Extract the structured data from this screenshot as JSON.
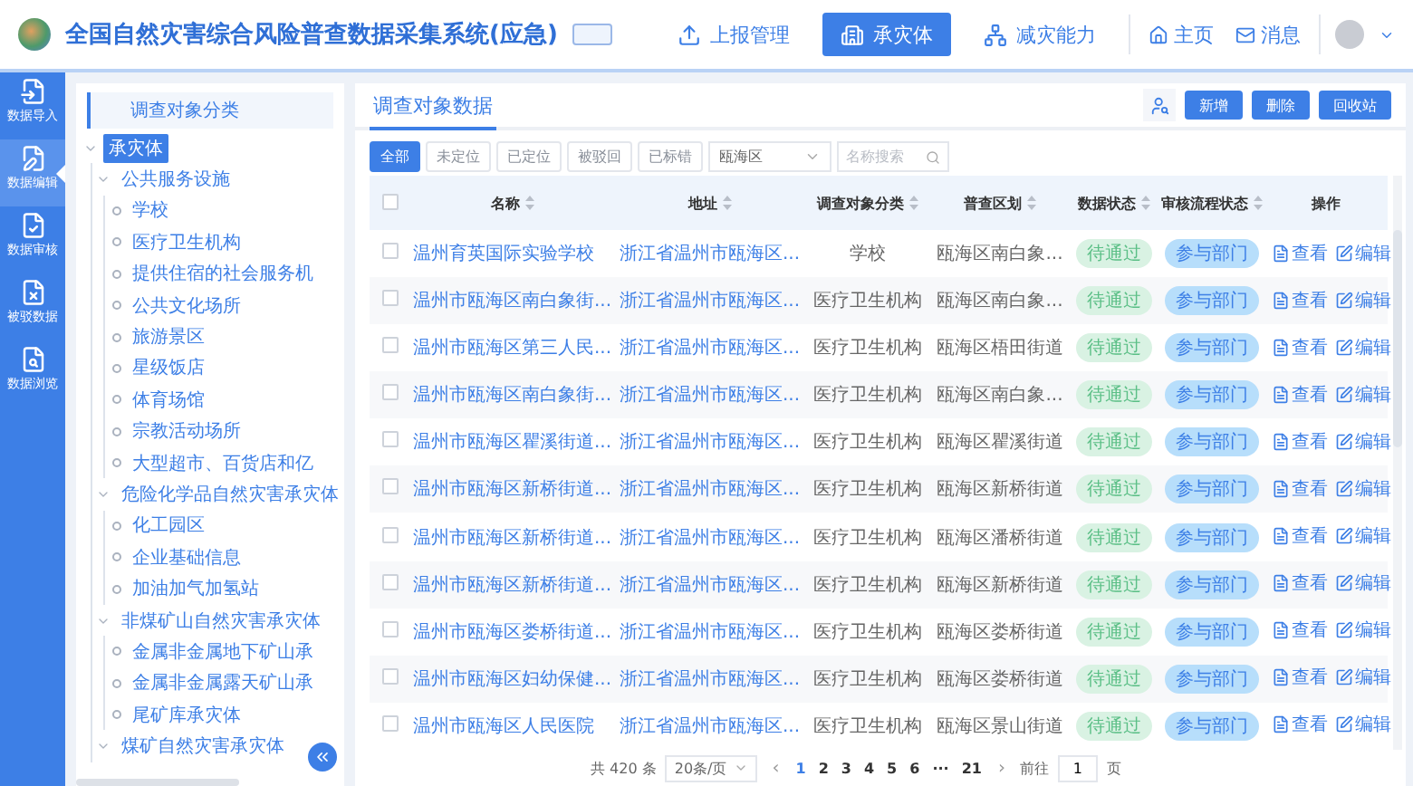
{
  "header": {
    "title": "全国自然灾害综合风险普查数据采集系统(应急)",
    "nav": [
      {
        "label": "上报管理",
        "selected": false
      },
      {
        "label": "承灾体",
        "selected": true
      },
      {
        "label": "减灾能力",
        "selected": false
      }
    ],
    "links": [
      {
        "label": "主页"
      },
      {
        "label": "消息"
      }
    ]
  },
  "rail": [
    {
      "label": "数据导入",
      "selected": false
    },
    {
      "label": "数据编辑",
      "selected": true
    },
    {
      "label": "数据审核",
      "selected": false
    },
    {
      "label": "被驳数据",
      "selected": false
    },
    {
      "label": "数据浏览",
      "selected": false
    }
  ],
  "tree": {
    "title": "调查对象分类",
    "items": [
      {
        "label": "承灾体",
        "selected": true,
        "expanded": true,
        "children": [
          {
            "label": "公共服务设施",
            "selected": false,
            "expanded": true,
            "children": [
              {
                "label": "学校"
              },
              {
                "label": "医疗卫生机构"
              },
              {
                "label": "提供住宿的社会服务机"
              },
              {
                "label": "公共文化场所"
              },
              {
                "label": "旅游景区"
              },
              {
                "label": "星级饭店"
              },
              {
                "label": "体育场馆"
              },
              {
                "label": "宗教活动场所"
              },
              {
                "label": "大型超市、百货店和亿"
              }
            ]
          },
          {
            "label": "危险化学品自然灾害承灾体",
            "selected": false,
            "expanded": true,
            "children": [
              {
                "label": "化工园区"
              },
              {
                "label": "企业基础信息"
              },
              {
                "label": "加油加气加氢站"
              }
            ]
          },
          {
            "label": "非煤矿山自然灾害承灾体",
            "selected": false,
            "expanded": true,
            "children": [
              {
                "label": "金属非金属地下矿山承"
              },
              {
                "label": "金属非金属露天矿山承"
              },
              {
                "label": "尾矿库承灾体"
              }
            ]
          },
          {
            "label": "煤矿自然灾害承灾体",
            "selected": false,
            "expanded": true
          }
        ]
      }
    ]
  },
  "main": {
    "title": "调查对象数据",
    "buttons": [
      "新增",
      "删除",
      "回收站"
    ],
    "filters": [
      {
        "label": "全部",
        "selected": true
      },
      {
        "label": "未定位",
        "selected": false
      },
      {
        "label": "已定位",
        "selected": false
      },
      {
        "label": "被驳回",
        "selected": false
      },
      {
        "label": "已标错",
        "selected": false
      }
    ],
    "district_select": "瓯海区",
    "search": {
      "placeholder": "名称搜索"
    },
    "table": {
      "select_all_checked": false,
      "columns": [
        {
          "label": "名称",
          "sortable": true
        },
        {
          "label": "地址",
          "sortable": true
        },
        {
          "label": "调查对象分类",
          "sortable": true
        },
        {
          "label": "普查区划",
          "sortable": true
        },
        {
          "label": "数据状态",
          "sortable": true
        },
        {
          "label": "审核流程状态",
          "sortable": true
        },
        {
          "label": "操作",
          "sortable": false
        }
      ],
      "rows": [
        {
          "checked": false,
          "name": "温州育英国际实验学校",
          "address": "浙江省温州市瓯海区...",
          "category": "学校",
          "district": "瓯海区南白象...",
          "status": "待通过",
          "flow": "参与部门",
          "view": "查看",
          "edit": "编辑"
        },
        {
          "checked": false,
          "name": "温州市瓯海区南白象街...",
          "address": "浙江省温州市瓯海区...",
          "category": "医疗卫生机构",
          "district": "瓯海区南白象...",
          "status": "待通过",
          "flow": "参与部门",
          "view": "查看",
          "edit": "编辑"
        },
        {
          "checked": false,
          "name": "温州市瓯海区第三人民...",
          "address": "浙江省温州市瓯海区...",
          "category": "医疗卫生机构",
          "district": "瓯海区梧田街道",
          "status": "待通过",
          "flow": "参与部门",
          "view": "查看",
          "edit": "编辑"
        },
        {
          "checked": false,
          "name": "温州市瓯海区南白象街...",
          "address": "浙江省温州市瓯海区...",
          "category": "医疗卫生机构",
          "district": "瓯海区南白象...",
          "status": "待通过",
          "flow": "参与部门",
          "view": "查看",
          "edit": "编辑"
        },
        {
          "checked": false,
          "name": "温州市瓯海区瞿溪街道...",
          "address": "浙江省温州市瓯海区...",
          "category": "医疗卫生机构",
          "district": "瓯海区瞿溪街道",
          "status": "待通过",
          "flow": "参与部门",
          "view": "查看",
          "edit": "编辑"
        },
        {
          "checked": false,
          "name": "温州市瓯海区新桥街道...",
          "address": "浙江省温州市瓯海区...",
          "category": "医疗卫生机构",
          "district": "瓯海区新桥街道",
          "status": "待通过",
          "flow": "参与部门",
          "view": "查看",
          "edit": "编辑"
        },
        {
          "checked": false,
          "name": "温州市瓯海区新桥街道...",
          "address": "浙江省温州市瓯海区...",
          "category": "医疗卫生机构",
          "district": "瓯海区潘桥街道",
          "status": "待通过",
          "flow": "参与部门",
          "view": "查看",
          "edit": "编辑"
        },
        {
          "checked": false,
          "name": "温州市瓯海区新桥街道...",
          "address": "浙江省温州市瓯海区...",
          "category": "医疗卫生机构",
          "district": "瓯海区新桥街道",
          "status": "待通过",
          "flow": "参与部门",
          "view": "查看",
          "edit": "编辑"
        },
        {
          "checked": false,
          "name": "温州市瓯海区娄桥街道...",
          "address": "浙江省温州市瓯海区...",
          "category": "医疗卫生机构",
          "district": "瓯海区娄桥街道",
          "status": "待通过",
          "flow": "参与部门",
          "view": "查看",
          "edit": "编辑"
        },
        {
          "checked": false,
          "name": "温州市瓯海区妇幼保健...",
          "address": "浙江省温州市瓯海区...",
          "category": "医疗卫生机构",
          "district": "瓯海区娄桥街道",
          "status": "待通过",
          "flow": "参与部门",
          "view": "查看",
          "edit": "编辑"
        },
        {
          "checked": false,
          "name": "温州市瓯海区人民医院",
          "address": "浙江省温州市瓯海区...",
          "category": "医疗卫生机构",
          "district": "瓯海区景山街道",
          "status": "待通过",
          "flow": "参与部门",
          "view": "查看",
          "edit": "编辑"
        }
      ]
    },
    "pagination": {
      "total": "共 420 条",
      "page_size": "20条/页",
      "prev": "‹",
      "pages": [
        {
          "label": "1",
          "selected": true
        },
        {
          "label": "2",
          "selected": false
        },
        {
          "label": "3",
          "selected": false
        },
        {
          "label": "4",
          "selected": false
        },
        {
          "label": "5",
          "selected": false
        },
        {
          "label": "6",
          "selected": false
        },
        {
          "label": "···",
          "selected": false
        },
        {
          "label": "21",
          "selected": false
        }
      ],
      "next": "›",
      "goto_label": "前往",
      "goto_value": "1",
      "goto_unit": "页"
    }
  }
}
